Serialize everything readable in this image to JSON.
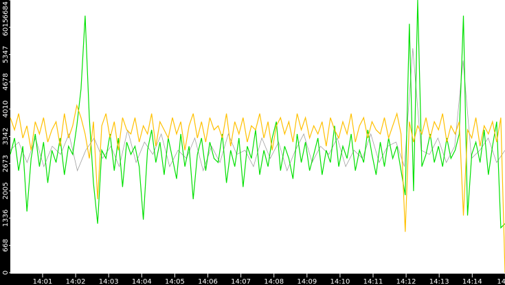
{
  "chart_data": {
    "type": "line",
    "title": "",
    "xlabel": "",
    "ylabel": "",
    "ylim": [
      0,
      6684
    ],
    "yticks": [
      "0",
      "668",
      "1336",
      "2005",
      "2673",
      "3342",
      "4010",
      "4678",
      "5347",
      "6015",
      "6684"
    ],
    "xticks": [
      "14:01",
      "14:02",
      "14:03",
      "14:04",
      "14:05",
      "14:06",
      "14:07",
      "14:08",
      "14:09",
      "14:10",
      "14:11",
      "14:12",
      "14:13",
      "14:14",
      "14"
    ],
    "grid": false,
    "series": [
      {
        "name": "gray",
        "color": "#a0a0a0",
        "values": [
          3000,
          3200,
          2700,
          3300,
          2600,
          3100,
          2900,
          3400,
          2500,
          3000,
          3300,
          2800,
          3100,
          2600,
          3500,
          2700,
          3200,
          2900,
          3400,
          2600,
          3000,
          2800,
          3300,
          2500,
          3100,
          2700,
          3400,
          2900,
          3000,
          2600,
          3300,
          2800,
          3200,
          2500,
          3000,
          3400,
          2700,
          3100,
          2900,
          3300,
          2600,
          3000,
          2800,
          3400,
          2700,
          3100,
          3200,
          2600,
          5500,
          3000,
          2900,
          3300,
          2700,
          3100,
          5200,
          2800,
          3000,
          3300,
          2700,
          3000
        ]
      },
      {
        "name": "green",
        "color": "#00e000",
        "values": [
          2900,
          3300,
          2500,
          3100,
          1500,
          2800,
          3400,
          2600,
          3200,
          2200,
          3000,
          2700,
          3300,
          2400,
          3100,
          2900,
          3600,
          4500,
          6300,
          3800,
          2200,
          1200,
          3000,
          2800,
          3400,
          2500,
          3300,
          2100,
          3200,
          2900,
          3100,
          2600,
          1300,
          3000,
          3500,
          2700,
          3200,
          2400,
          3300,
          2800,
          2300,
          3400,
          2600,
          3100,
          1800,
          2900,
          3300,
          2500,
          3200,
          2800,
          2700,
          3400,
          2200,
          3000,
          2600,
          3300,
          2100,
          3100,
          2800,
          3500,
          2400,
          3000,
          2600,
          3300,
          3700,
          2500,
          3100,
          2800,
          2300,
          3400,
          2700,
          3200,
          2500,
          2900,
          3300,
          2400,
          3000,
          2700,
          3600,
          2600,
          3100,
          2800,
          3400,
          2500,
          3000,
          2700,
          3500,
          2900,
          2400,
          3200,
          2600,
          3300,
          2800,
          3100,
          2500,
          1900,
          6100,
          2000,
          6684,
          2600,
          2900,
          3400,
          2700,
          3100,
          2600,
          3300,
          2800,
          3000,
          3400,
          6300,
          1400,
          2900,
          3200,
          2700,
          3500,
          2400,
          3100,
          3700,
          1100,
          1200
        ]
      },
      {
        "name": "orange",
        "color": "#ffc000",
        "values": [
          3800,
          3500,
          3900,
          3300,
          3600,
          3000,
          3700,
          3400,
          3800,
          3200,
          3500,
          3700,
          3100,
          3900,
          3300,
          3600,
          4100,
          3800,
          3400,
          2800,
          3700,
          1800,
          3600,
          3900,
          3300,
          3700,
          3000,
          3800,
          3500,
          3400,
          3800,
          3200,
          3600,
          3400,
          3900,
          3100,
          3700,
          3500,
          3300,
          3800,
          3400,
          3700,
          3000,
          3600,
          3900,
          3300,
          3700,
          3200,
          3800,
          3500,
          3600,
          3300,
          3900,
          3100,
          3700,
          3400,
          3800,
          3200,
          3600,
          3500,
          3900,
          3300,
          3700,
          3000,
          3600,
          3800,
          3400,
          3700,
          3200,
          3900,
          3500,
          3800,
          3300,
          3600,
          3400,
          3700,
          3100,
          3800,
          3500,
          3300,
          3700,
          3400,
          3900,
          3200,
          3600,
          3800,
          3300,
          3700,
          3500,
          3400,
          3800,
          3300,
          3600,
          3900,
          3400,
          1000,
          3700,
          3200,
          3600,
          3400,
          3800,
          3300,
          3700,
          3500,
          3900,
          3200,
          3600,
          3400,
          3700,
          1400,
          3500,
          3300,
          3800,
          3100,
          3600,
          3400,
          3700,
          3200,
          3800,
          0
        ]
      }
    ]
  }
}
